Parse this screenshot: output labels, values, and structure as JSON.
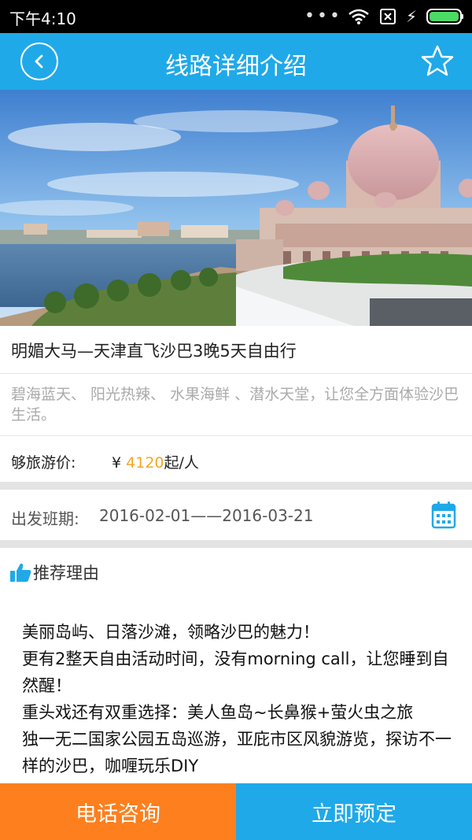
{
  "status": {
    "time": "下午4:10",
    "icons": [
      "more-dots-icon",
      "wifi-icon",
      "no-sim-icon",
      "charging-icon",
      "battery-icon"
    ]
  },
  "nav": {
    "title": "线路详细介绍",
    "back_icon": "back-circle-icon",
    "favorite_icon": "star-outline-icon"
  },
  "route": {
    "title": "明媚大马—天津直飞沙巴3晚5天自由行",
    "description": "碧海蓝天、 阳光热辣、 水果海鲜 、潜水天堂，让您全方面体验沙巴生活。",
    "price_label": "够旅游价:",
    "currency": "¥",
    "price": "4120",
    "price_unit": "起/人",
    "departure_label": "出发班期:",
    "departure_range": "2016-02-01——2016-03-21"
  },
  "recommend": {
    "title": "推荐理由",
    "lines": [
      "美丽岛屿、日落沙滩，领略沙巴的魅力！",
      "更有2整天自由活动时间，没有morning call，让您睡到自然醒！",
      "重头戏还有双重选择：美人鱼岛~长鼻猴+萤火虫之旅",
      "独一无二国家公园五岛巡游，亚庇市区风貌游览，探访不一样的沙巴，咖喱玩乐DIY"
    ]
  },
  "actions": {
    "call": "电话咨询",
    "book": "立即预定"
  },
  "colors": {
    "primary": "#1FA9E9",
    "accent_orange": "#FE7F1E",
    "price": "#F5A623"
  }
}
